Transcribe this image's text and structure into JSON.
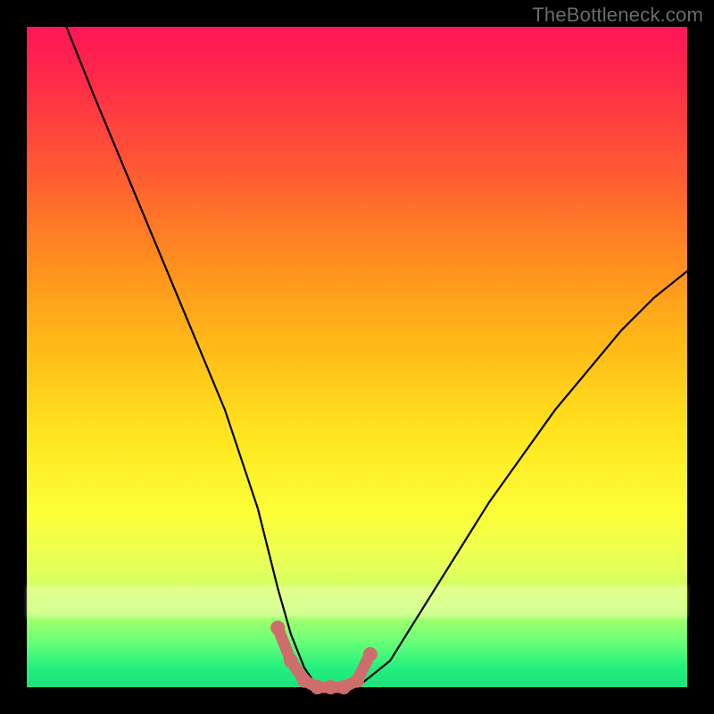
{
  "watermark": "TheBottleneck.com",
  "chart_data": {
    "type": "line",
    "title": "",
    "xlabel": "",
    "ylabel": "",
    "xlim": [
      0,
      100
    ],
    "ylim": [
      0,
      100
    ],
    "series": [
      {
        "name": "bottleneck-curve",
        "x": [
          6,
          10,
          15,
          20,
          25,
          30,
          35,
          38,
          40,
          42,
          44,
          46,
          48,
          50,
          55,
          60,
          65,
          70,
          75,
          80,
          85,
          90,
          95,
          100
        ],
        "values": [
          100,
          90,
          78,
          66,
          54,
          42,
          27,
          15,
          8,
          3,
          0,
          0,
          0,
          0,
          4,
          12,
          20,
          28,
          35,
          42,
          48,
          54,
          59,
          63
        ]
      }
    ],
    "highlight": {
      "name": "optimal-range",
      "color": "#cf6d6c",
      "x": [
        38,
        40,
        42,
        44,
        46,
        48,
        50,
        52
      ],
      "values": [
        9,
        4,
        1,
        0,
        0,
        0,
        1,
        5
      ]
    }
  }
}
